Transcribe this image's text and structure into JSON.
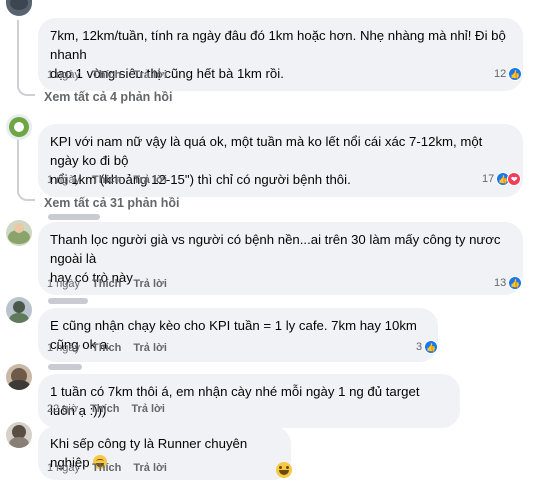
{
  "comments": [
    {
      "text": "7km, 12km/tuần, tính ra ngày đâu đó 1km hoặc hơn. Nhẹ nhàng mà nhỉ! Đi bộ nhanh\ndạo 1 vòng siêu thị cũng hết bà 1km rồi.",
      "time": "1 ngày",
      "like_label": "Thích",
      "reply_label": "Trả lời",
      "reactions": "12",
      "see_replies": "Xem tất cả 4 phản hồi"
    },
    {
      "text": "KPI với nam nữ vậy là quá ok, một tuần mà ko lết nổi cái xác 7-12km, một ngày ko đi bộ\nnổi 1km (khoảng 12-15\") thì chỉ có người bệnh thôi.",
      "time": "1 ngày",
      "like_label": "Thích",
      "reply_label": "Trả lời",
      "reactions": "17",
      "see_replies": "Xem tất cả 31 phản hồi"
    },
    {
      "text": "Thanh lọc người già vs người có bệnh nền...ai trên 30 làm mấy công ty nươc ngoài là\nhay có trò này",
      "time": "1 ngày",
      "like_label": "Thích",
      "reply_label": "Trả lời",
      "reactions": "13"
    },
    {
      "text": "E cũng nhận chạy kèo cho KPI tuần = 1 ly cafe. 7km hay 10km cũng ok ạ.",
      "time": "1 ngày",
      "like_label": "Thích",
      "reply_label": "Trả lời",
      "reactions": "3"
    },
    {
      "text": "1 tuần có 7km thôi á, em nhận cày nhé mỗi ngày 1 ng đủ target luôn ạ :)))",
      "time": "22 giờ",
      "like_label": "Thích",
      "reply_label": "Trả lời"
    },
    {
      "text": "Khi sếp công ty là Runner chuyên nghiệp",
      "time": "1 ngày",
      "like_label": "Thích",
      "reply_label": "Trả lời"
    }
  ],
  "icons": {
    "like": "like-icon",
    "heart": "heart-icon",
    "emoji": "grinning-emoji-icon"
  },
  "colors": {
    "bubble": "#f0f2f5",
    "meta_text": "#65676b",
    "like_blue": "#1877f2",
    "heart_red": "#f33e58"
  }
}
